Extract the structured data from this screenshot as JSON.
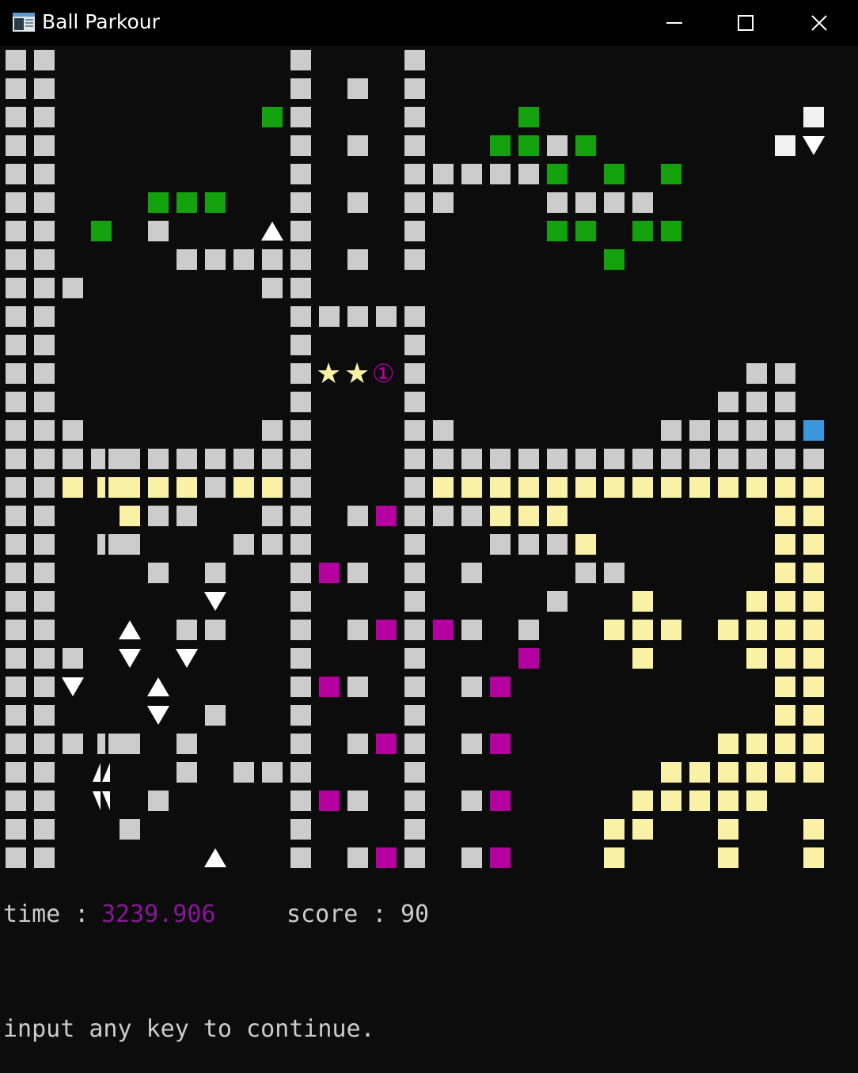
{
  "window": {
    "title": "Ball Parkour",
    "icons": {
      "app": "console-app-icon",
      "minimize": "minimize-icon",
      "maximize": "maximize-icon",
      "close": "close-icon"
    }
  },
  "colors": {
    "wall": "#cccccc",
    "grass": "#13a10e",
    "sand": "#f9f1a5",
    "portal": "#b4009e",
    "goal": "#3a96dd",
    "block": "#f2f2f2",
    "background": "#0c0c0c"
  },
  "hud": {
    "time_label": "time :",
    "time_value": "3239.906",
    "score_label": "score :",
    "score_value": "90",
    "prompt": "input any key to continue."
  },
  "board_items": {
    "stars": [
      "★",
      "★"
    ],
    "coin": "①"
  }
}
